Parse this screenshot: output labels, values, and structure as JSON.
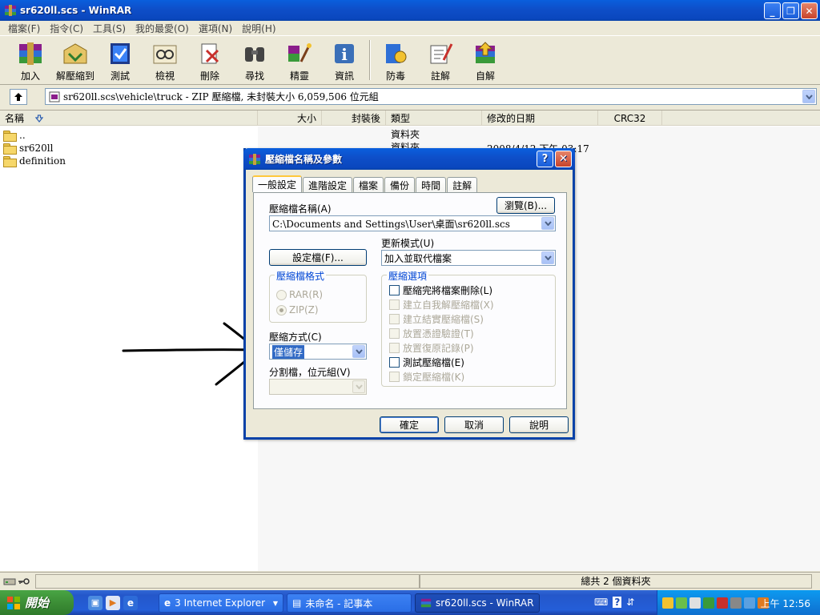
{
  "window": {
    "title": "sr620ll.scs - WinRAR"
  },
  "menu": [
    "檔案(F)",
    "指令(C)",
    "工具(S)",
    "我的最愛(O)",
    "選項(N)",
    "說明(H)"
  ],
  "toolbar": [
    {
      "label": "加入",
      "icon": "add-archive-icon"
    },
    {
      "label": "解壓縮到",
      "icon": "extract-to-icon"
    },
    {
      "label": "測試",
      "icon": "test-icon"
    },
    {
      "label": "檢視",
      "icon": "view-icon"
    },
    {
      "label": "刪除",
      "icon": "delete-icon"
    },
    {
      "label": "尋找",
      "icon": "find-icon"
    },
    {
      "label": "精靈",
      "icon": "wizard-icon"
    },
    {
      "label": "資訊",
      "icon": "info-icon"
    },
    {
      "label": "防毒",
      "icon": "virus-scan-icon"
    },
    {
      "label": "註解",
      "icon": "comment-icon"
    },
    {
      "label": "自解",
      "icon": "sfx-icon"
    }
  ],
  "address": {
    "path": "sr620ll.scs\\vehicle\\truck - ZIP 壓縮檔, 未封裝大小 6,059,506 位元組"
  },
  "columns": [
    "名稱",
    "大小",
    "封裝後",
    "類型",
    "修改的日期",
    "CRC32"
  ],
  "files": [
    {
      "name": "..",
      "type": "資料夾",
      "date": ""
    },
    {
      "name": "sr620ll",
      "type": "資料夾",
      "date": "2008/4/12 下午 03:17"
    },
    {
      "name": "definition",
      "type": "",
      "date": ""
    }
  ],
  "status": {
    "text": "總共 2 個資料夾"
  },
  "dialog": {
    "title": "壓縮檔名稱及參數",
    "tabs": [
      "一般設定",
      "進階設定",
      "檔案",
      "備份",
      "時間",
      "註解"
    ],
    "archive_name_label": "壓縮檔名稱(A)",
    "archive_name_value": "C:\\Documents and Settings\\User\\桌面\\sr620ll.scs",
    "browse_button": "瀏覽(B)...",
    "profiles_button": "設定檔(F)...",
    "update_mode_label": "更新模式(U)",
    "update_mode_value": "加入並取代檔案",
    "format_group": "壓縮檔格式",
    "format_rar": "RAR(R)",
    "format_zip": "ZIP(Z)",
    "method_label": "壓縮方式(C)",
    "method_value": "僅儲存",
    "split_label": "分割檔，位元組(V)",
    "options_group": "壓縮選項",
    "options": [
      {
        "label": "壓縮完將檔案刪除(L)",
        "enabled": true
      },
      {
        "label": "建立自我解壓縮檔(X)",
        "enabled": false
      },
      {
        "label": "建立結實壓縮檔(S)",
        "enabled": false
      },
      {
        "label": "放置憑證驗證(T)",
        "enabled": false
      },
      {
        "label": "放置復原記錄(P)",
        "enabled": false
      },
      {
        "label": "測試壓縮檔(E)",
        "enabled": true
      },
      {
        "label": "鎖定壓縮檔(K)",
        "enabled": false
      }
    ],
    "ok_button": "確定",
    "cancel_button": "取消",
    "help_button": "說明"
  },
  "taskbar": {
    "start_label": "開始",
    "tasks": [
      {
        "label": "3 Internet Explorer"
      },
      {
        "label": "未命名 - 記事本"
      },
      {
        "label": "sr620ll.scs - WinRAR"
      }
    ],
    "clock": "上午 12:56"
  },
  "colors": {
    "titlebar": "#0A47BE",
    "selection": "#316AC5",
    "groupbox_title": "#0046D5",
    "taskbar": "#245ED8",
    "start_button": "#3C8E36"
  }
}
